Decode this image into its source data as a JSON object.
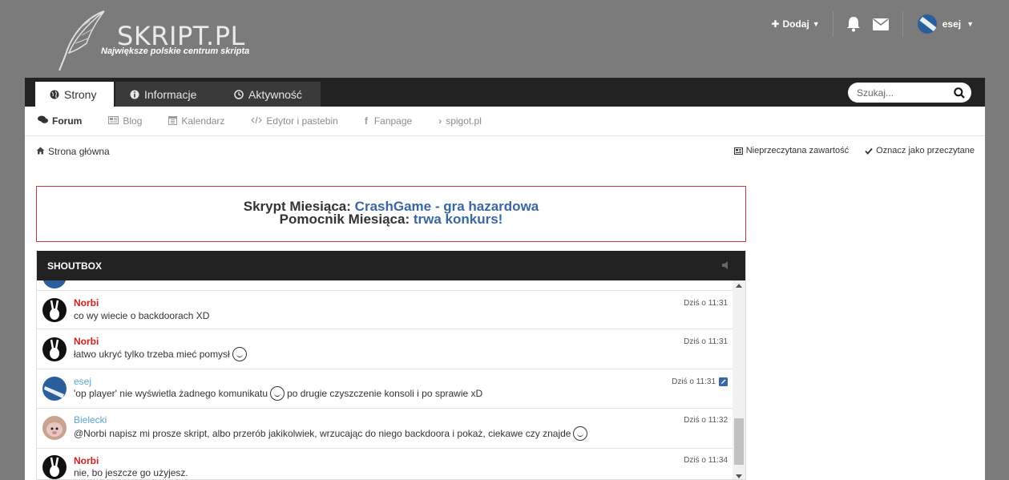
{
  "site": {
    "title": "SKRIPT.PL",
    "subtitle": "Największe polskie centrum skripta"
  },
  "user_nav": {
    "add_label": "Dodaj",
    "username": "esej"
  },
  "tabs": [
    {
      "label": "Strony",
      "icon": "globe-icon",
      "active": true
    },
    {
      "label": "Informacje",
      "icon": "info-icon",
      "active": false
    },
    {
      "label": "Aktywność",
      "icon": "clock-icon",
      "active": false
    }
  ],
  "search": {
    "placeholder": "Szukaj..."
  },
  "subnav": [
    {
      "label": "Forum",
      "icon": "comments-icon",
      "active": true
    },
    {
      "label": "Blog",
      "icon": "newspaper-icon",
      "active": false
    },
    {
      "label": "Kalendarz",
      "icon": "calendar-icon",
      "active": false
    },
    {
      "label": "Edytor i pastebin",
      "icon": "code-icon",
      "active": false
    },
    {
      "label": "Fanpage",
      "icon": "facebook-icon",
      "active": false
    },
    {
      "label": "spigot.pl",
      "icon": "chevron-right-icon",
      "active": false
    }
  ],
  "breadcrumb": {
    "home": "Strona główna"
  },
  "quick_links": {
    "unread": "Nieprzeczytana zawartość",
    "mark_read": "Oznacz jako przeczytane"
  },
  "motm": {
    "script_label": "Skrypt Miesiąca:",
    "script_link": "CrashGame - gra hazardowa",
    "helper_label": "Pomocnik Miesiąca:",
    "helper_link": "trwa konkurs!"
  },
  "shoutbox": {
    "title": "SHOUTBOX",
    "messages": [
      {
        "author": "Norbi",
        "text": "co wy wiecie o backdoorach XD",
        "time": "Dziś o 11:31"
      },
      {
        "author": "Norbi",
        "text": "łatwo ukryć tylko trzeba mieć pomysł",
        "time": "Dziś o 11:31"
      },
      {
        "author": "esej",
        "text_a": "'op player' nie wyświetla żadnego komunikatu",
        "text_b": "po drugie czyszczenie konsoli i po sprawie xD",
        "time": "Dziś o 11:31"
      },
      {
        "author": "Bielecki",
        "text": "@Norbi napisz mi prosze skript, albo przerób jakikolwiek, wrzucając do niego backdoora i pokaż, ciekawe czy znajde",
        "time": "Dziś o 11:32"
      },
      {
        "author": "Norbi",
        "text": "nie, bo jeszcze go użyjesz.",
        "time": "Dziś o 11:34"
      }
    ]
  }
}
